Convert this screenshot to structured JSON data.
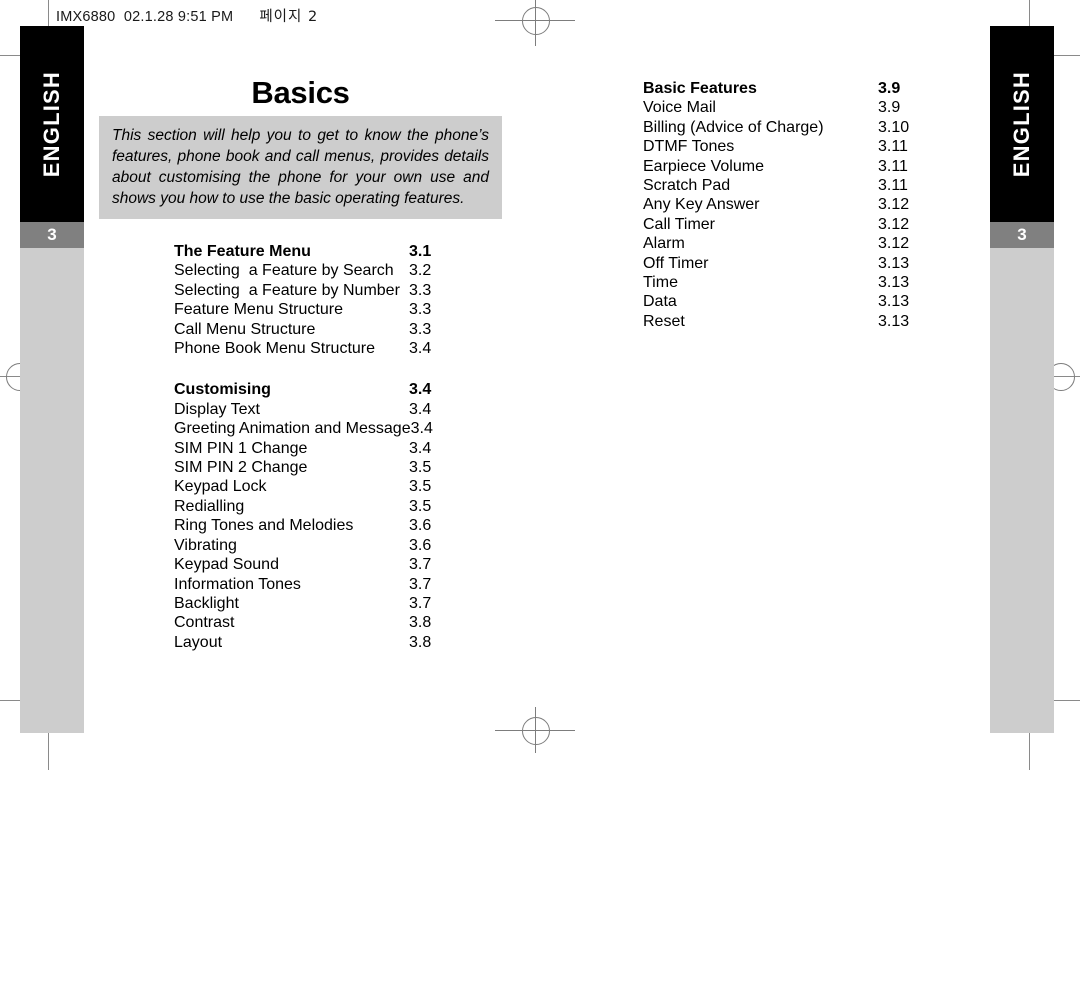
{
  "scan_header": {
    "file_and_time": "IMX6880  02.1.28 9:51 PM",
    "page_label": "페이지 2"
  },
  "tabs": {
    "left": {
      "label": "ENGLISH",
      "number": "3"
    },
    "right": {
      "label": "ENGLISH",
      "number": "3"
    }
  },
  "content": {
    "title": "Basics",
    "intro": "This section will help you to get to know the phone’s features, phone book and call menus, provides details about customising the phone for your own use and shows you how to use the basic operating features."
  },
  "toc": {
    "left_sections": [
      {
        "heading": {
          "title": "The Feature Menu",
          "page": "3.1"
        },
        "entries": [
          {
            "title": "Selecting  a Feature by Search",
            "page": "3.2"
          },
          {
            "title": "Selecting  a Feature by Number",
            "page": "3.3"
          },
          {
            "title": "Feature Menu Structure",
            "page": "3.3"
          },
          {
            "title": "Call Menu Structure",
            "page": "3.3"
          },
          {
            "title": "Phone Book Menu Structure",
            "page": "3.4"
          }
        ]
      },
      {
        "heading": {
          "title": "Customising",
          "page": "3.4"
        },
        "entries": [
          {
            "title": "Display Text",
            "page": "3.4"
          },
          {
            "title": "Greeting Animation and Message",
            "page": "3.4"
          },
          {
            "title": "SIM PIN 1 Change",
            "page": "3.4"
          },
          {
            "title": "SIM PIN 2 Change",
            "page": "3.5"
          },
          {
            "title": "Keypad Lock",
            "page": "3.5"
          },
          {
            "title": "Redialling",
            "page": "3.5"
          },
          {
            "title": "Ring Tones and Melodies",
            "page": "3.6"
          },
          {
            "title": "Vibrating",
            "page": "3.6"
          },
          {
            "title": "Keypad Sound",
            "page": "3.7"
          },
          {
            "title": "Information Tones",
            "page": "3.7"
          },
          {
            "title": "Backlight",
            "page": "3.7"
          },
          {
            "title": "Contrast",
            "page": "3.8"
          },
          {
            "title": "Layout",
            "page": "3.8"
          }
        ]
      }
    ],
    "right_sections": [
      {
        "heading": {
          "title": "Basic Features",
          "page": "3.9"
        },
        "entries": [
          {
            "title": "Voice Mail",
            "page": "3.9"
          },
          {
            "title": "Billing (Advice of Charge)",
            "page": "3.10"
          },
          {
            "title": "DTMF Tones",
            "page": "3.11"
          },
          {
            "title": "Earpiece Volume",
            "page": "3.11"
          },
          {
            "title": "Scratch Pad",
            "page": "3.11"
          },
          {
            "title": "Any Key Answer",
            "page": "3.12"
          },
          {
            "title": "Call Timer",
            "page": "3.12"
          },
          {
            "title": "Alarm",
            "page": "3.12"
          },
          {
            "title": "Off Timer",
            "page": "3.13"
          },
          {
            "title": "Time",
            "page": "3.13"
          },
          {
            "title": "Data",
            "page": "3.13"
          },
          {
            "title": "Reset",
            "page": "3.13"
          }
        ]
      }
    ]
  },
  "colors": {
    "tab_black": "#000000",
    "tab_number_gray": "#808080",
    "panel_gray": "#cdcdcd",
    "mark_gray": "#8a8a8a"
  }
}
